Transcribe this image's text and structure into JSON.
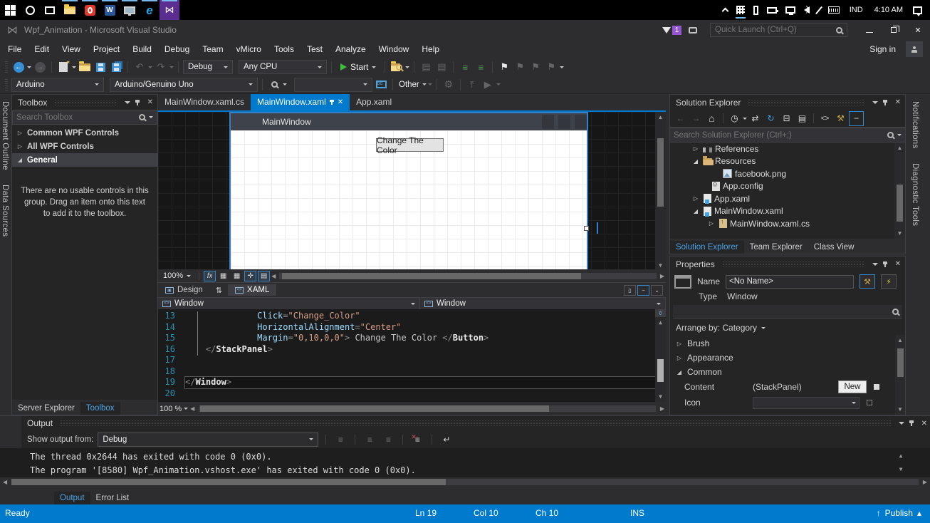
{
  "colors": {
    "accent": "#007acc",
    "taskbar_vs_purple": "#5c2d91",
    "panel_bg": "#252526",
    "chrome_bg": "#2d2d30",
    "string_orange": "#d69d85",
    "attribute_blue": "#9cdcfe",
    "line_number_blue": "#2b91af",
    "folder_tan": "#dcb67a"
  },
  "icons": {
    "close": "✕",
    "collapsed": "▷",
    "expanded": "◢",
    "home": "⌂",
    "refresh": "↻",
    "sync": "⇄",
    "history_clock": "◷",
    "collapse_all": "⊟",
    "view_code": "<>",
    "wrench": "⚒",
    "gear": "⚙",
    "undo": "↶",
    "redo": "↷",
    "bookmark": "⚑",
    "swap_panes": "⇅",
    "splitter": "⇕",
    "up": "▲",
    "down": "▼",
    "left": "◀",
    "right": "▶",
    "back": "←",
    "forward": "→",
    "lines": "≡",
    "grid": "▦",
    "page": "▤",
    "target": "✛",
    "split_vertical": "▯",
    "split_horizontal": "−",
    "collapse_pane": "⌄",
    "wordwrap": "↵",
    "upload": "⤒",
    "play_circle": "▶",
    "bolt": "⚡",
    "up_arrow": "↑",
    "small_up": "▴",
    "fx": "fx"
  },
  "taskbar": {
    "lang": "IND",
    "time": "4:10 AM"
  },
  "titlebar": {
    "title": "Wpf_Animation - Microsoft Visual Studio",
    "badge": "1",
    "quick_launch_placeholder": "Quick Launch (Ctrl+Q)"
  },
  "menubar": {
    "items": [
      "File",
      "Edit",
      "View",
      "Project",
      "Build",
      "Debug",
      "Team",
      "vMicro",
      "Tools",
      "Test",
      "Analyze",
      "Window",
      "Help"
    ],
    "sign_in": "Sign in"
  },
  "toolbar": {
    "configuration": "Debug",
    "platform": "Any CPU",
    "start": "Start",
    "board": "Arduino",
    "port": "Arduino/Genuino Uno",
    "other": "Other"
  },
  "side_tabs": {
    "left": [
      "Document Outline",
      "Data Sources"
    ],
    "right": [
      "Notifications",
      "Diagnostic Tools"
    ]
  },
  "toolbox": {
    "title": "Toolbox",
    "search_placeholder": "Search Toolbox",
    "groups": [
      "Common WPF Controls",
      "All WPF Controls",
      "General"
    ],
    "empty_message": "There are no usable controls in this group. Drag an item onto this text to add it to the toolbox.",
    "bottom_tabs": [
      "Server Explorer",
      "Toolbox"
    ]
  },
  "editor": {
    "tabs": [
      "MainWindow.xaml.cs",
      "MainWindow.xaml",
      "App.xaml"
    ],
    "zoom": "100%",
    "zoom_bottom": "100 %",
    "design_tab": "Design",
    "xaml_tab": "XAML",
    "breadcrumbs": [
      "Window",
      "Window"
    ]
  },
  "designer": {
    "window_title": "MainWindow",
    "button_label": "Change The Color"
  },
  "xaml": {
    "lines": [
      {
        "n": 13,
        "parts": [
          [
            "ws",
            "              "
          ],
          [
            "t-attr",
            "Click"
          ],
          [
            "t-op",
            "="
          ],
          [
            "t-str",
            "\"Change_Color\""
          ]
        ]
      },
      {
        "n": 14,
        "parts": [
          [
            "ws",
            "              "
          ],
          [
            "t-attr",
            "HorizontalAlignment"
          ],
          [
            "t-op",
            "="
          ],
          [
            "t-str",
            "\"Center\""
          ]
        ]
      },
      {
        "n": 15,
        "parts": [
          [
            "ws",
            "              "
          ],
          [
            "t-attr",
            "Margin"
          ],
          [
            "t-op",
            "="
          ],
          [
            "t-str",
            "\"0,10,0,0\""
          ],
          [
            "t-op",
            "> "
          ],
          [
            "t-txt",
            "Change The Color "
          ],
          [
            "t-op",
            "</"
          ],
          [
            "t-el",
            "Button"
          ],
          [
            "t-op",
            ">"
          ]
        ]
      },
      {
        "n": 16,
        "parts": [
          [
            "ws",
            "    "
          ],
          [
            "t-op",
            "</"
          ],
          [
            "t-el",
            "StackPanel"
          ],
          [
            "t-op",
            ">"
          ]
        ]
      },
      {
        "n": 17,
        "parts": []
      },
      {
        "n": 18,
        "parts": []
      },
      {
        "n": 19,
        "current": true,
        "parts": [
          [
            "t-op",
            "</"
          ],
          [
            "t-el",
            "Window"
          ],
          [
            "t-op",
            ">"
          ]
        ]
      },
      {
        "n": 20,
        "parts": []
      }
    ]
  },
  "solution_explorer": {
    "title": "Solution Explorer",
    "search_placeholder": "Search Solution Explorer (Ctrl+;)",
    "items": [
      {
        "label": "References"
      },
      {
        "label": "Resources"
      },
      {
        "label": "facebook.png"
      },
      {
        "label": "App.config"
      },
      {
        "label": "App.xaml"
      },
      {
        "label": "MainWindow.xaml"
      },
      {
        "label": "MainWindow.xaml.cs"
      }
    ],
    "bottom_tabs": [
      "Solution Explorer",
      "Team Explorer",
      "Class View"
    ]
  },
  "properties": {
    "title": "Properties",
    "name_label": "Name",
    "name_value": "<No Name>",
    "type_label": "Type",
    "type_value": "Window",
    "arrange_label": "Arrange by: Category",
    "sections": [
      "Brush",
      "Appearance",
      "Common"
    ],
    "content_label": "Content",
    "content_value": "(StackPanel)",
    "new_button": "New",
    "icon_label": "Icon"
  },
  "output": {
    "title": "Output",
    "show_from": "Show output from:",
    "source": "Debug",
    "lines": [
      "The thread 0x2644 has exited with code 0 (0x0).",
      "The program '[8580] Wpf_Animation.vshost.exe' has exited with code 0 (0x0)."
    ],
    "bottom_tabs": [
      "Output",
      "Error List"
    ]
  },
  "statusbar": {
    "state": "Ready",
    "line": "Ln 19",
    "column": "Col 10",
    "character": "Ch 10",
    "mode": "INS",
    "publish": "Publish"
  }
}
